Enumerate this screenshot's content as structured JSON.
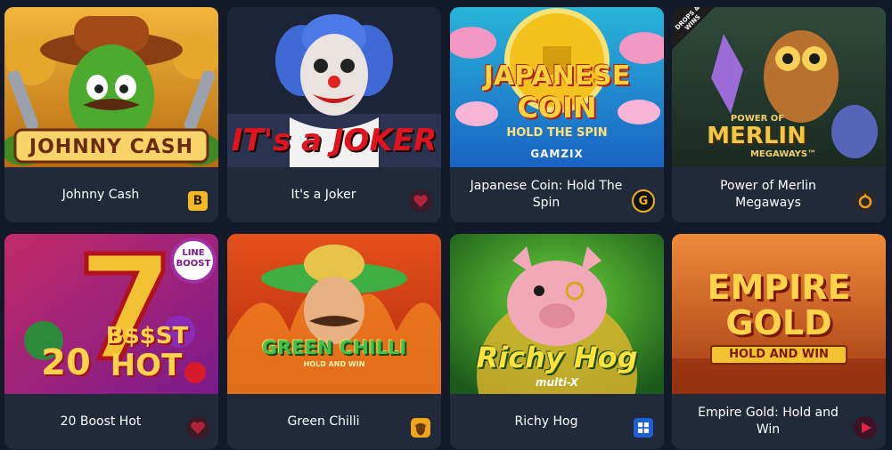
{
  "games": [
    {
      "title": "Johnny Cash",
      "logo": "JOHNNY CASH",
      "provider_icon": "bgaming-icon"
    },
    {
      "title": "It's a Joker",
      "logo": "IT's a JOKER",
      "provider_icon": "red-heart-provider-icon"
    },
    {
      "title": "Japanese Coin: Hold The Spin",
      "logo_line1": "JAPANESE",
      "logo_line2": "COIN",
      "tagline": "HOLD THE SPIN",
      "studio": "GAMZIX",
      "provider_icon": "gamzix-icon"
    },
    {
      "title": "Power of Merlin Megaways",
      "logo_top": "POWER OF",
      "logo_main": "MERLIN",
      "logo_sub": "MEGAWAYS™",
      "badge": "DROPS & WINS",
      "provider_icon": "pragmatic-icon"
    },
    {
      "title": "20 Boost Hot",
      "logo_line1": "B$$ST",
      "logo_line2": "20",
      "logo_line3": "HOT",
      "badge": "LINE BOOST",
      "provider_icon": "red-heart-provider-icon"
    },
    {
      "title": "Green Chilli",
      "logo": "GREEN CHILLI",
      "tagline": "HOLD AND WIN",
      "provider_icon": "acorn-provider-icon"
    },
    {
      "title": "Richy Hog",
      "logo": "Richy Hog",
      "tagline": "multi-X",
      "provider_icon": "blueprint-icon"
    },
    {
      "title": "Empire Gold: Hold and Win",
      "logo_line1": "EMPIRE",
      "logo_line2": "GOLD",
      "tagline": "HOLD AND WIN",
      "provider_icon": "play-provider-icon"
    }
  ]
}
